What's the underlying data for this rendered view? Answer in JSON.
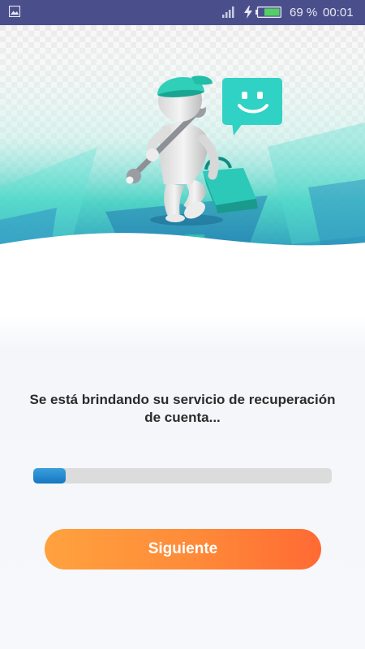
{
  "status_bar": {
    "battery": "69 %",
    "time": "00:01"
  },
  "main": {
    "message": "Se está brindando su servicio de recuperación de cuenta...",
    "progress_fraction": 0.11,
    "next_button_label": "Siguiente"
  },
  "colors": {
    "status_bar": "#4a4f8c",
    "progress_fill": "#1a7fc8",
    "progress_track": "#dcdcdc",
    "button_gradient_start": "#ffa23e",
    "button_gradient_end": "#ff6a33",
    "accent_teal": "#2fd2c4"
  },
  "icons": {
    "status_left": "gallery-icon",
    "signal": "signal-icon",
    "charging": "charging-icon",
    "battery": "battery-icon",
    "hero_bubble": "smiley-chat-bubble-icon"
  }
}
